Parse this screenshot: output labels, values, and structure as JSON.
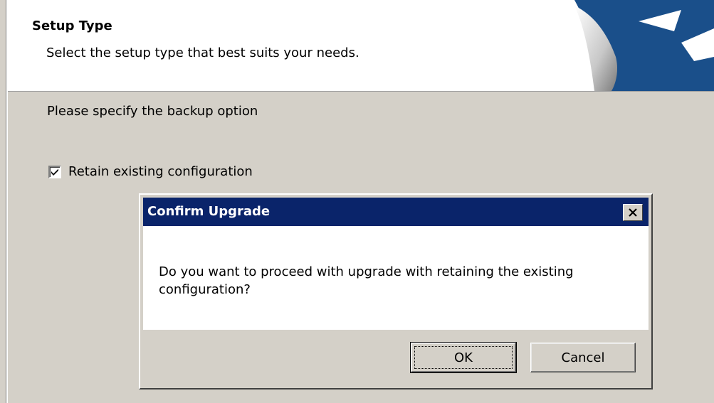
{
  "banner": {
    "title": "Setup Type",
    "subtitle": "Select the setup type that best suits your needs.",
    "logo_icon": "installer-logo-icon"
  },
  "body": {
    "section_label": "Please specify the backup option",
    "retain_checkbox": {
      "label": "Retain existing configuration",
      "checked": true
    }
  },
  "dialog": {
    "title": "Confirm Upgrade",
    "message": "Do you want to proceed with upgrade with retaining the existing configuration?",
    "ok_label": "OK",
    "cancel_label": "Cancel",
    "close_icon": "close-icon"
  },
  "colors": {
    "titlebar": "#0a246a",
    "dialog_face": "#d4d0c8",
    "logo_blue": "#1a4f8a"
  }
}
